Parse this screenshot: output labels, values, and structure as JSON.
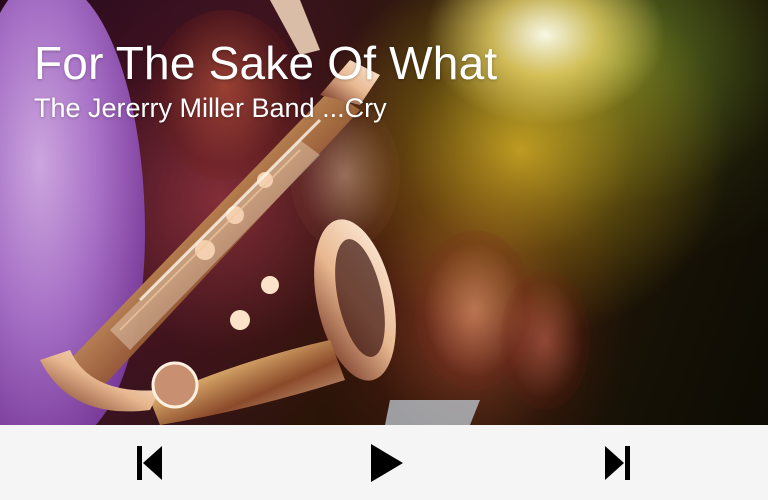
{
  "track": {
    "title": "For The Sake Of What",
    "artist": "The Jererry Miller Band ...Cry"
  },
  "artwork": {
    "subject": "saxophone-player-concert-photo"
  },
  "controls": {
    "previous_icon": "skip-previous-icon",
    "play_icon": "play-icon",
    "next_icon": "skip-next-icon",
    "icon_color": "#000000",
    "bar_color": "#f5f5f5"
  }
}
